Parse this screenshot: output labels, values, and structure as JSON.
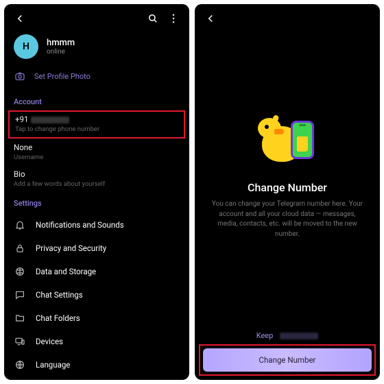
{
  "left": {
    "avatar_letter": "H",
    "username": "hmmm",
    "status": "online",
    "set_photo": "Set Profile Photo",
    "account_label": "Account",
    "phone_prefix": "+91",
    "phone_sub": "Tap to change phone number",
    "username_val": "None",
    "username_sub": "Username",
    "bio_val": "Bio",
    "bio_sub": "Add a few words about yourself",
    "settings_label": "Settings",
    "items": [
      {
        "label": "Notifications and Sounds"
      },
      {
        "label": "Privacy and Security"
      },
      {
        "label": "Data and Storage"
      },
      {
        "label": "Chat Settings"
      },
      {
        "label": "Chat Folders"
      },
      {
        "label": "Devices"
      },
      {
        "label": "Language"
      }
    ]
  },
  "right": {
    "title": "Change Number",
    "desc": "You can change your Telegram number here. Your account and all your cloud data — messages, media, contacts, etc. will be moved to the new number.",
    "keep": "Keep",
    "button": "Change Number"
  }
}
